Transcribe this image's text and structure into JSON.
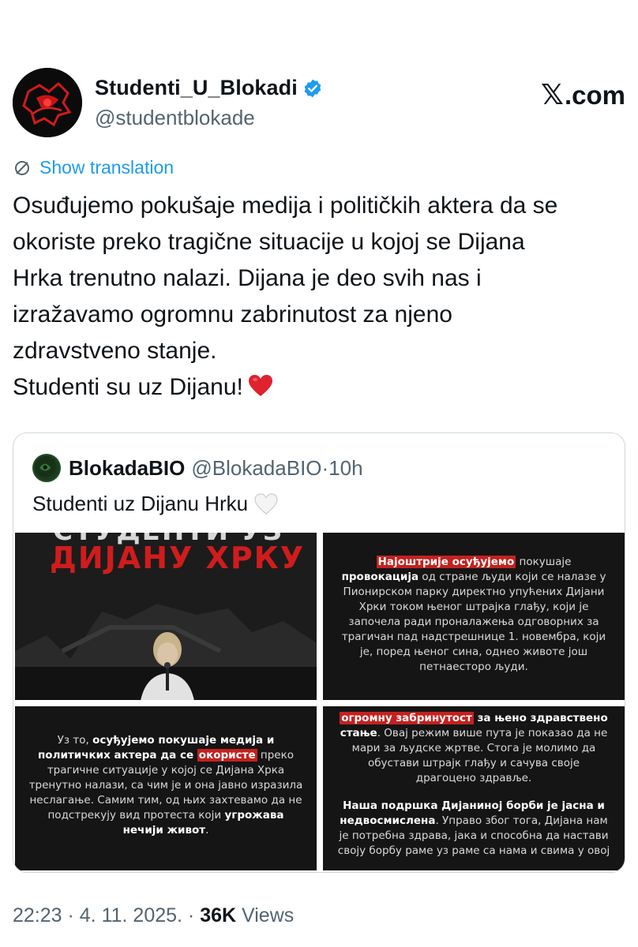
{
  "author": {
    "display_name": "Studenti_U_Blokadi",
    "handle": "@studentblokade",
    "verified": true,
    "avatar_icon": "red-logo-avatar"
  },
  "site": {
    "label": ".com",
    "mark": "𝕏"
  },
  "translate_label": "Show translation",
  "tweet": {
    "lines": [
      "Osuđujemo pokušaje medija i političkih aktera da se",
      "okoriste preko tragične situacije u kojoj se Dijana",
      "Hrka trenutno nalazi. Dijana je deo svih nas i",
      "izražavamo ogromnu zabrinutost za njeno",
      "zdravstveno stanje.",
      "Studenti su uz Dijanu!"
    ],
    "emoji": "red-heart-emoji"
  },
  "quoted": {
    "display_name": "BlokadaBIO",
    "handle": "@BlokadaBIO",
    "separator": "·",
    "time": "10h",
    "text": "Studenti uz Dijanu Hrku",
    "emoji": "white-heart-emoji",
    "images": {
      "tile1": {
        "title_top": "СТУДЕНТИ УЗ",
        "title": "ДИЈАНУ ХРКУ"
      },
      "tile2": {
        "hl1": "Најоштрије осуђујемо",
        "t1": " покушаје",
        "b1": "провокација",
        "t2": " од стране људи који се налазе у Пионирском парку директно упућених Дијани Хрки током њеног штрајка глађу, који је започела ради проналажења одговорних за трагичан пад надстрешнице 1. новембра, који је, поред њеног сина, однео животе још петнаесторо људи."
      },
      "tile3": {
        "t1": "Уз то, ",
        "b1": "осуђујемо покушаје медија и политичких актера да се ",
        "hl1": "окористе",
        "t2": " преко трагичне ситуације у којој се Дијана Хрка тренутно налази, са чим је и она јавно изразила неслагање. Самим тим, од њих захтевамо да не подстрекују вид протеста који ",
        "b2": "угрожава нечији живот",
        "t3": "."
      },
      "tile4": {
        "hl1": "огромну забринутост",
        "b1": " за њено здравствено стање",
        "t1": ". Овај режим више пута је показао да не мари за људске жртве. Стога је молимо да обустави штрајк глађу и сачува своје драгоцено здравље.",
        "b2": "Наша подршка Дијаниној борби је јасна и недвосмислена",
        "t2": ". Управо због тога, Дијана нам је потребна здрава, јака и способна да настави своју борбу раме уз раме са нама и свима у овој"
      }
    }
  },
  "footer": {
    "time": "22:23",
    "sep1": " · ",
    "date": "4. 11. 2025.",
    "sep2": " · ",
    "views_count": "36K",
    "views_label": " Views"
  },
  "colors": {
    "link_blue": "#1d9bf0",
    "verified_blue": "#1d9bf0",
    "muted_text": "#536471",
    "highlight_red": "#c3211f"
  }
}
